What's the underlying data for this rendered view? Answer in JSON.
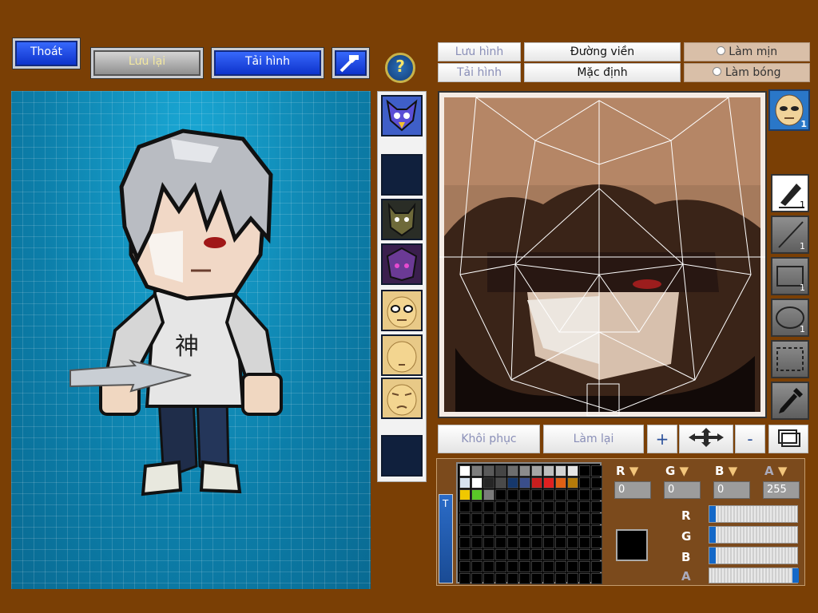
{
  "toolbar": {
    "exit_label": "Thoát",
    "save_label": "Lưu lại",
    "load_label": "Tải hình",
    "help_label": "?"
  },
  "editor_header": {
    "save_image": "Lưu hình",
    "outline": "Đường viền",
    "smooth": "Làm mịn",
    "load_image": "Tải hình",
    "default": "Mặc định",
    "shine": "Làm bóng"
  },
  "bottom_buttons": {
    "restore": "Khôi phục",
    "redo": "Làm lại",
    "zoom_in": "+",
    "zoom_out": "-"
  },
  "tools": {
    "face_count": "1",
    "pen_count": "1",
    "line_count": "1",
    "rect_count": "1",
    "ellipse_count": "1"
  },
  "color": {
    "channels": [
      "R",
      "G",
      "B",
      "A"
    ],
    "r_value": "0",
    "g_value": "0",
    "b_value": "0",
    "a_value": "255",
    "r_level": 0,
    "g_level": 0,
    "b_level": 0,
    "a_level": 1,
    "current": "#000000",
    "palette_tab": "T",
    "palette": [
      [
        "#ffffff",
        "#7d7d7d",
        "#5a5a5a",
        "#454545",
        "#6e6e6e",
        "#8c8c8c",
        "#a5a5a5",
        "#bdbdbd",
        "#d2d2d2",
        "#e6e6e6"
      ],
      [
        "#d7e3f0",
        "#ffffff",
        "#262626",
        "#4a4a4a",
        "#16386c",
        "#3a4e8a",
        "#c81e1e",
        "#e02020",
        "#e06014",
        "#b47a0a"
      ],
      [
        "#f0c800",
        "#5ac828",
        "#7a7a7a"
      ]
    ]
  },
  "preview_bg": "#0f86b4",
  "page_bg": "#7a3f05"
}
